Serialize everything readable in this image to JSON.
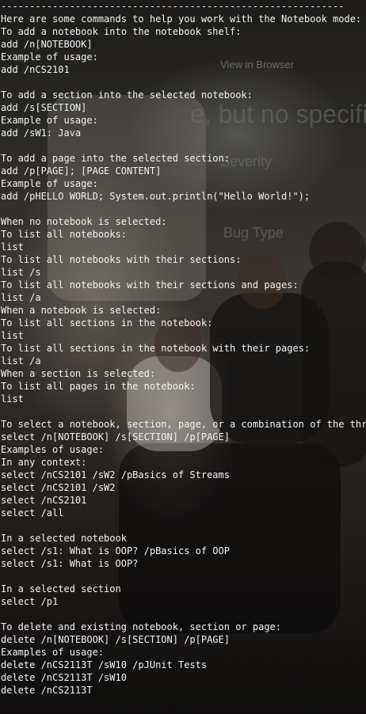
{
  "background": {
    "ghost_browser_link": "View in Browser",
    "ghost_heading": "e, but no specified in",
    "ghost_severity": "Severity",
    "ghost_bugtype": "Bug Type"
  },
  "terminal": {
    "lines": [
      "------------------------------------------------------------",
      "Here are some commands to help you work with the Notebook mode:",
      "To add a notebook into the notebook shelf:",
      "add /n[NOTEBOOK]",
      "Example of usage:",
      "add /nCS2101",
      "",
      "To add a section into the selected notebook:",
      "add /s[SECTION]",
      "Example of usage:",
      "add /sW1: Java",
      "",
      "To add a page into the selected section:",
      "add /p[PAGE]; [PAGE CONTENT]",
      "Example of usage:",
      "add /pHELLO WORLD; System.out.println(\"Hello World!\");",
      "",
      "When no notebook is selected:",
      "To list all notebooks:",
      "list",
      "To list all notebooks with their sections:",
      "list /s",
      "To list all notebooks with their sections and pages:",
      "list /a",
      "When a notebook is selected:",
      "To list all sections in the notebook:",
      "list",
      "To list all sections in the notebook with their pages:",
      "list /a",
      "When a section is selected:",
      "To list all pages in the notebook:",
      "list",
      "",
      "To select a notebook, section, page, or a combination of the three",
      "select /n[NOTEBOOK] /s[SECTION] /p[PAGE]",
      "Examples of usage:",
      "In any context:",
      "select /nCS2101 /sW2 /pBasics of Streams",
      "select /nCS2101 /sW2",
      "select /nCS2101",
      "select /all",
      "",
      "In a selected notebook",
      "select /s1: What is OOP? /pBasics of OOP",
      "select /s1: What is OOP?",
      "",
      "In a selected section",
      "select /p1",
      "",
      "To delete and existing notebook, section or page:",
      "delete /n[NOTEBOOK] /s[SECTION] /p[PAGE]",
      "Examples of usage:",
      "delete /nCS2113T /sW10 /pJUnit Tests",
      "delete /nCS2113T /sW10",
      "delete /nCS2113T",
      "",
      "------------------------------------------------------------"
    ]
  }
}
